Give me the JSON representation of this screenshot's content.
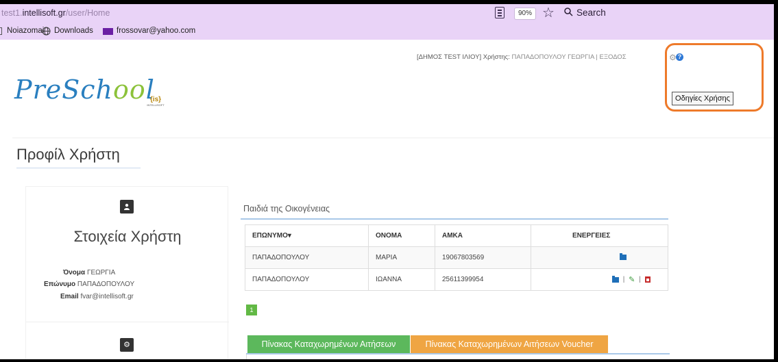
{
  "browser": {
    "url_prefix": "test1.",
    "url_host": "intellisoft.gr",
    "url_path": "/user/Home",
    "zoom": "90%",
    "search_placeholder": "Search",
    "bookmarks": [
      {
        "label": "Noiazomai"
      },
      {
        "label": "Downloads"
      },
      {
        "label": "frossovar@yahoo.com"
      }
    ]
  },
  "header": {
    "org": "[ΔΗΜΟΣ TEST ΙΛΙΟΥ]",
    "user_label": "Χρήστης:",
    "user_name": "ΠΑΠΑΔΟΠΟΥΛΟΥ ΓΕΩΡΓΙΑ",
    "divider": "|",
    "logout": "ΕΞΟΔΟΣ",
    "help_button": "Οδηγίες Χρήσης",
    "help_glyph": "?"
  },
  "logo": {
    "part1": "PreSch",
    "part2": "oo",
    "part3": "l",
    "partner_top": "{is}",
    "partner_bottom": "INTELLISOFT"
  },
  "page": {
    "title": "Προφίλ Χρήστη"
  },
  "user_panel": {
    "heading": "Στοιχεία Χρήστη",
    "fields": [
      {
        "label": "Όνομα",
        "value": "ΓΕΩΡΓΙΑ"
      },
      {
        "label": "Επώνυμο",
        "value": "ΠΑΠΑΔΟΠΟΥΛΟΥ"
      },
      {
        "label": "Email",
        "value": "fvar@intellisoft.gr"
      }
    ]
  },
  "family": {
    "heading": "Παιδιά της Οικογένειας",
    "columns": [
      "ΕΠΩΝΥΜΟ▾",
      "ΟΝΟΜΑ",
      "ΑΜΚΑ",
      "ΕΝΕΡΓΕΙΕΣ"
    ],
    "rows": [
      {
        "surname": "ΠΑΠΑΔΟΠΟΥΛΟΥ",
        "name": "ΜΑΡΙΑ",
        "amka": "19067803569"
      },
      {
        "surname": "ΠΑΠΑΔΟΠΟΥΛΟΥ",
        "name": "ΙΩΑΝΝΑ",
        "amka": "25611399954"
      }
    ],
    "action_separator": "|",
    "page": "1"
  },
  "tabs": {
    "applications": "Πίνακας Καταχωρημένων Αιτήσεων",
    "vouchers": "Πίνακας Καταχωρημένων Αιτήσεων Voucher"
  },
  "colors": {
    "chrome_bg": "#e9d3f7",
    "highlight": "#ee7a2a",
    "green": "#5cb85c",
    "orange": "#efa543",
    "link_blue": "#1e6fb8"
  }
}
